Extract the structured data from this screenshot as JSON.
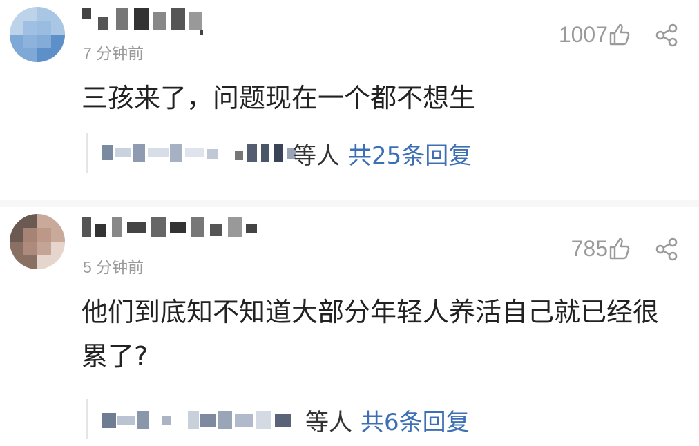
{
  "comments": [
    {
      "time": "7 分钟前",
      "likes": "1007",
      "text": "三孩来了，问题现在一个都不想生",
      "reply_suffix": "等人",
      "reply_count_text": "共25条回复"
    },
    {
      "time": "5 分钟前",
      "likes": "785",
      "text": "他们到底知不知道大部分年轻人养活自己就已经很累了?",
      "reply_suffix": "等人",
      "reply_count_text": "共6条回复"
    }
  ],
  "icons": {
    "like": "thumbs-up-icon",
    "share": "share-icon"
  },
  "colors": {
    "meta_text": "#9a9a9a",
    "reply_link": "#3d6fb4"
  }
}
